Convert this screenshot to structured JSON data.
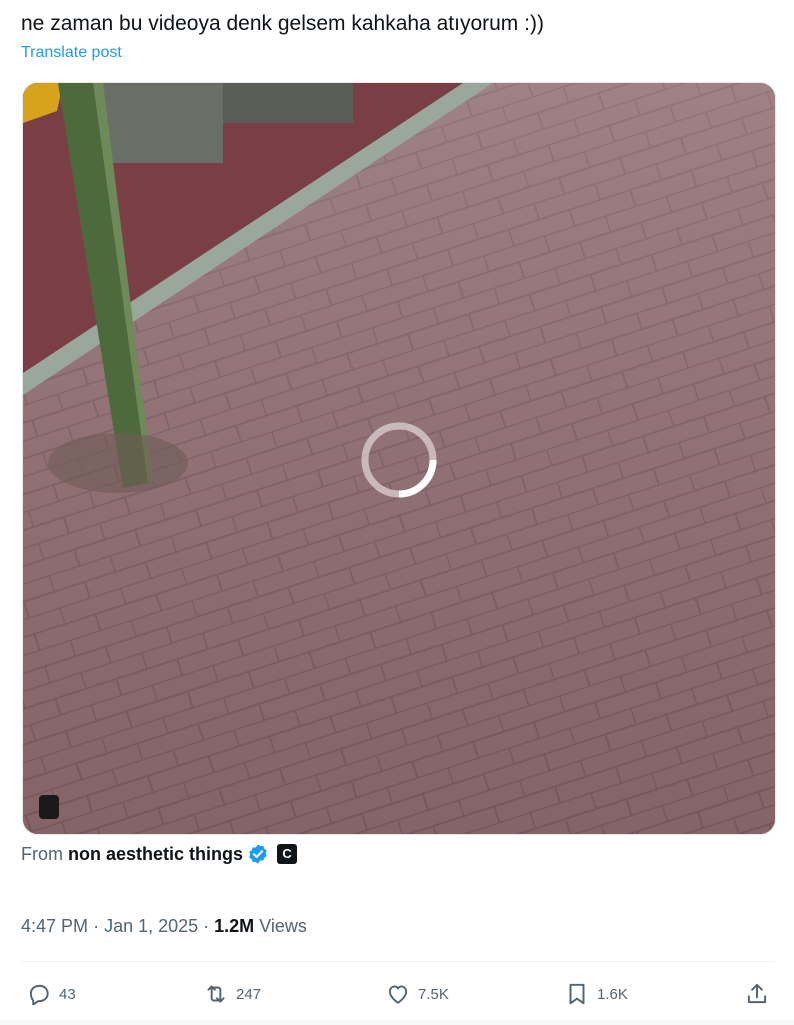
{
  "post": {
    "text": "ne zaman bu videoya denk gelsem kahkaha atıyorum :))",
    "translate_label": "Translate post"
  },
  "media": {
    "state": "loading",
    "badge_icon": "media-badge-icon"
  },
  "source": {
    "prefix": "From",
    "name": "non aesthetic things",
    "verified_icon": "verified-badge-icon",
    "badge_letter": "C"
  },
  "meta": {
    "time": "4:47 PM",
    "date": "Jan 1, 2025",
    "views_count": "1.2M",
    "views_label": "Views"
  },
  "actions": {
    "replies": "43",
    "reposts": "247",
    "likes": "7.5K",
    "bookmarks": "1.6K"
  },
  "colors": {
    "link": "#1d9bf0",
    "secondary_text": "#536471",
    "verified": "#1d9bf0"
  }
}
